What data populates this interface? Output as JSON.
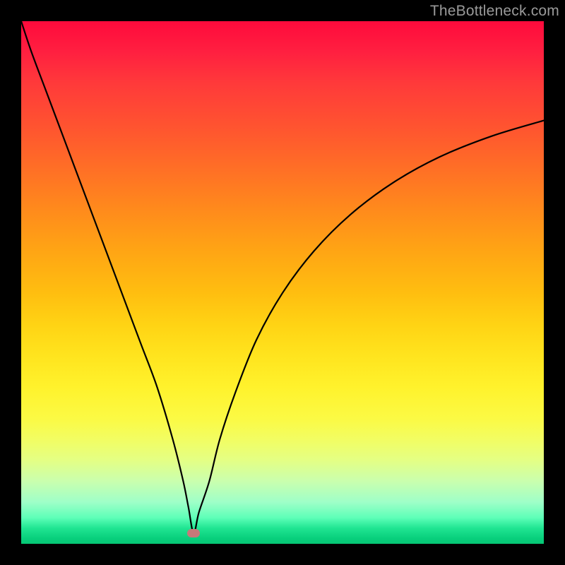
{
  "watermark": "TheBottleneck.com",
  "chart_data": {
    "type": "line",
    "title": "",
    "xlabel": "",
    "ylabel": "",
    "xlim": [
      0,
      100
    ],
    "ylim": [
      0,
      100
    ],
    "grid": false,
    "background": "rainbow-vertical",
    "min_point": {
      "x": 33,
      "y": 2
    },
    "series": [
      {
        "name": "bottleneck-curve",
        "x": [
          0,
          2,
          5,
          8,
          11,
          14,
          17,
          20,
          23,
          26,
          29,
          31,
          32,
          33,
          34,
          36,
          38,
          41,
          45,
          50,
          56,
          63,
          71,
          80,
          90,
          100
        ],
        "y": [
          100,
          94,
          86,
          78,
          70,
          62,
          54,
          46,
          38,
          30,
          20,
          12,
          7,
          2,
          6,
          12,
          20,
          29,
          39,
          48,
          56,
          63,
          69,
          74,
          78,
          81
        ]
      }
    ],
    "marker": {
      "x": 33,
      "y": 2,
      "shape": "rounded-rect",
      "color": "#c77979"
    }
  },
  "colors": {
    "frame": "#000000",
    "curve": "#000000",
    "marker": "#c77979",
    "watermark": "#9a9a9a"
  }
}
